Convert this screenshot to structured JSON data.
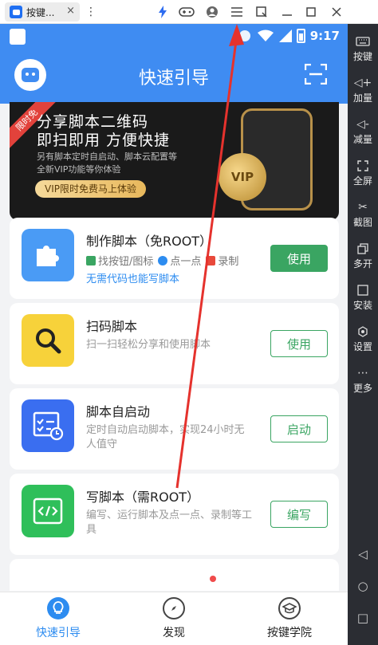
{
  "emulator": {
    "tab_title": "按键...",
    "tab_close": "×",
    "toolbar_icons": [
      "menu-dots-icon",
      "bolt-icon",
      "gamepad-icon",
      "user-icon",
      "hamburger-icon",
      "crop-icon",
      "minimize-icon",
      "maximize-icon",
      "close-icon"
    ]
  },
  "side_toolbar": {
    "items": [
      {
        "label": "按键",
        "icon": "keyboard-icon"
      },
      {
        "label": "加量",
        "icon": "volume-up-icon"
      },
      {
        "label": "减量",
        "icon": "volume-down-icon"
      },
      {
        "label": "全屏",
        "icon": "fullscreen-icon"
      },
      {
        "label": "截图",
        "icon": "scissors-icon"
      },
      {
        "label": "多开",
        "icon": "multi-open-icon"
      },
      {
        "label": "安装",
        "icon": "apk-icon"
      },
      {
        "label": "设置",
        "icon": "settings-icon"
      },
      {
        "label": "更多",
        "icon": "more-icon"
      }
    ],
    "nav": [
      "back-icon",
      "home-icon",
      "recents-icon"
    ]
  },
  "status_bar": {
    "time": "9:17"
  },
  "header": {
    "title": "快速引导"
  },
  "banner": {
    "ribbon": "限时免",
    "line1": "分享脚本二维码",
    "line2": "即扫即用 方便快捷",
    "line3": "另有脚本定时自启动、脚本云配置等",
    "line4": "全新VIP功能等你体验",
    "button": "VIP限时免费马上体验",
    "coin": "VIP"
  },
  "cards": [
    {
      "title": "制作脚本（免ROOT）",
      "features": [
        "找按钮/图标",
        "点一点",
        "录制"
      ],
      "highlight": "无需代码也能写脚本",
      "button": "使用",
      "button_style": "filled",
      "color": "#4a9bf5"
    },
    {
      "title": "扫码脚本",
      "desc": "扫一扫轻松分享和使用脚本",
      "button": "使用",
      "color": "#f7d23a"
    },
    {
      "title": "脚本自启动",
      "desc": "定时自动启动脚本，实现24小时无人值守",
      "button": "启动",
      "color": "#3a6ef0"
    },
    {
      "title": "写脚本（需ROOT）",
      "desc": "编写、运行脚本及点一点、录制等工具",
      "button": "编写",
      "color": "#2fbf5a"
    }
  ],
  "bottom_nav": {
    "items": [
      {
        "label": "快速引导",
        "active": true
      },
      {
        "label": "发现",
        "active": false
      },
      {
        "label": "按键学院",
        "active": false
      }
    ],
    "active_color": "#2d8cf0"
  }
}
